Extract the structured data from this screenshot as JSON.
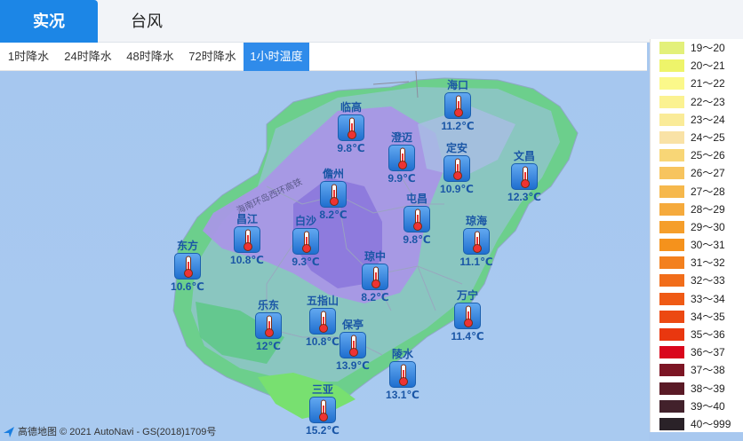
{
  "top_tabs": [
    {
      "label": "实况",
      "active": true
    },
    {
      "label": "台风",
      "active": false
    }
  ],
  "sub_tabs": [
    {
      "label": "1时降水",
      "active": false
    },
    {
      "label": "24时降水",
      "active": false
    },
    {
      "label": "48时降水",
      "active": false
    },
    {
      "label": "72时降水",
      "active": false
    },
    {
      "label": "1小时温度",
      "active": true
    }
  ],
  "road_label": "海南环岛西环高铁",
  "stations": [
    {
      "name": "海口",
      "temp": "11.2℃"
    },
    {
      "name": "临高",
      "temp": "9.8℃"
    },
    {
      "name": "澄迈",
      "temp": "9.9℃"
    },
    {
      "name": "定安",
      "temp": "10.9℃"
    },
    {
      "name": "文昌",
      "temp": "12.3℃"
    },
    {
      "name": "儋州",
      "temp": "8.2℃"
    },
    {
      "name": "屯昌",
      "temp": "9.8℃"
    },
    {
      "name": "昌江",
      "temp": "10.8℃"
    },
    {
      "name": "白沙",
      "temp": "9.3℃"
    },
    {
      "name": "琼海",
      "temp": "11.1℃"
    },
    {
      "name": "东方",
      "temp": "10.6℃"
    },
    {
      "name": "琼中",
      "temp": "8.2℃"
    },
    {
      "name": "五指山",
      "temp": "10.8℃"
    },
    {
      "name": "万宁",
      "temp": "11.4℃"
    },
    {
      "name": "乐东",
      "temp": "12℃"
    },
    {
      "name": "保亭",
      "temp": "13.9℃"
    },
    {
      "name": "陵水",
      "temp": "13.1℃"
    },
    {
      "name": "三亚",
      "temp": "15.2℃"
    }
  ],
  "attribution": "© 2021 AutoNavi - GS(2018)1709号",
  "attribution_logo_text": "高德地图",
  "legend": [
    {
      "label": "19～20",
      "color": "#e3f07a"
    },
    {
      "label": "20～21",
      "color": "#eef46a"
    },
    {
      "label": "21～22",
      "color": "#fbf88a"
    },
    {
      "label": "22～23",
      "color": "#fbf291"
    },
    {
      "label": "23～24",
      "color": "#faeb98"
    },
    {
      "label": "24～25",
      "color": "#f9e2a6"
    },
    {
      "label": "25～26",
      "color": "#f8d676"
    },
    {
      "label": "26～27",
      "color": "#f7c45e"
    },
    {
      "label": "27～28",
      "color": "#f6b84c"
    },
    {
      "label": "28～29",
      "color": "#f5aa3c"
    },
    {
      "label": "29～30",
      "color": "#f59e2b"
    },
    {
      "label": "30～31",
      "color": "#f5921c"
    },
    {
      "label": "31～32",
      "color": "#f3801e"
    },
    {
      "label": "32～33",
      "color": "#f16d1a"
    },
    {
      "label": "33～34",
      "color": "#ef5a15"
    },
    {
      "label": "34～35",
      "color": "#ec4912"
    },
    {
      "label": "35～36",
      "color": "#e9370f"
    },
    {
      "label": "36～37",
      "color": "#d9061c"
    },
    {
      "label": "37～38",
      "color": "#7c1524"
    },
    {
      "label": "38～39",
      "color": "#5a1a26"
    },
    {
      "label": "39～40",
      "color": "#42212b"
    },
    {
      "label": "40～999",
      "color": "#2a2228"
    }
  ]
}
